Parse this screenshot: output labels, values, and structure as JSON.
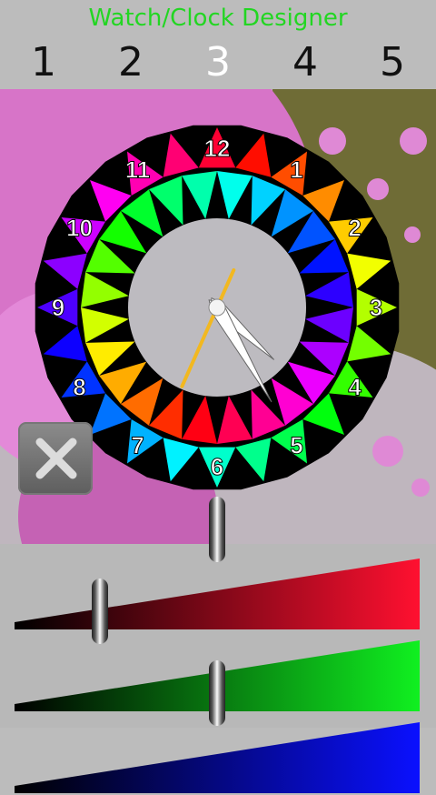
{
  "app": {
    "title": "Watch/Clock Designer"
  },
  "tabs": {
    "items": [
      "1",
      "2",
      "3",
      "4",
      "5"
    ],
    "selected_index": 2
  },
  "clock": {
    "hour_labels": [
      "12",
      "1",
      "2",
      "3",
      "4",
      "5",
      "6",
      "7",
      "8",
      "9",
      "10",
      "11"
    ],
    "time": {
      "hour": 4,
      "minute": 25,
      "second": 4
    },
    "colors": {
      "bezel": "#000000",
      "face": "#bdbbc0",
      "hands": "#ffffff",
      "second_hand": "#f2b820",
      "labels": "#ffffff"
    }
  },
  "close_button": {
    "icon": "close-x-icon"
  },
  "color_sliders": [
    {
      "channel": "red",
      "color": "#ff1030",
      "fraction": 0.5
    },
    {
      "channel": "green",
      "color": "#10f020",
      "fraction": 0.21
    },
    {
      "channel": "blue",
      "color": "#0a10ff",
      "fraction": 0.5
    }
  ]
}
